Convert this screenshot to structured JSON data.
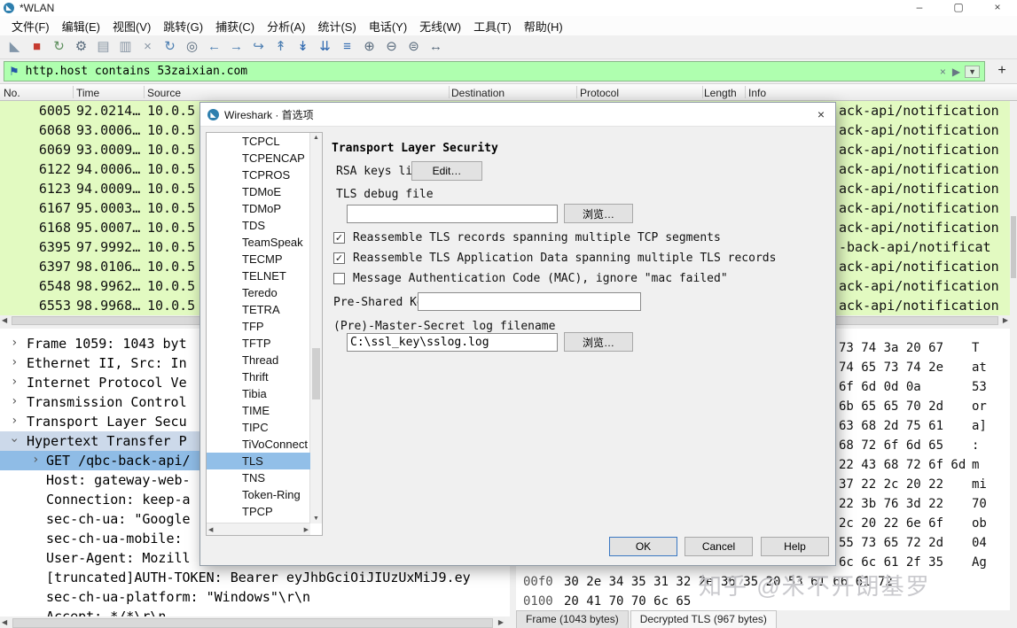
{
  "window": {
    "title": "*WLAN",
    "watermark": "知乎 @米不开朗基罗"
  },
  "menu": {
    "items": [
      "文件(F)",
      "编辑(E)",
      "视图(V)",
      "跳转(G)",
      "捕获(C)",
      "分析(A)",
      "统计(S)",
      "电话(Y)",
      "无线(W)",
      "工具(T)",
      "帮助(H)"
    ]
  },
  "toolbar": {
    "icons": [
      {
        "name": "start-capture-icon",
        "glyph": "◣",
        "color": "#8296a9"
      },
      {
        "name": "stop-capture-icon",
        "glyph": "■",
        "color": "#c63b30"
      },
      {
        "name": "restart-capture-icon",
        "glyph": "↻",
        "color": "#5d8f5d"
      },
      {
        "name": "capture-options-icon",
        "glyph": "⚙",
        "color": "#56687a"
      },
      {
        "name": "open-file-icon",
        "glyph": "▤",
        "color": "#8a97a5"
      },
      {
        "name": "save-file-icon",
        "glyph": "▥",
        "color": "#8a97a5"
      },
      {
        "name": "close-file-icon",
        "glyph": "×",
        "color": "#8a97a5"
      },
      {
        "name": "reload-file-icon",
        "glyph": "↻",
        "color": "#4d7fb2"
      },
      {
        "name": "find-packet-icon",
        "glyph": "◎",
        "color": "#56687a"
      },
      {
        "name": "go-back-icon",
        "glyph": "←",
        "color": "#4d7fb2"
      },
      {
        "name": "go-forward-icon",
        "glyph": "→",
        "color": "#4d7fb2"
      },
      {
        "name": "go-to-packet-icon",
        "glyph": "↪",
        "color": "#4d7fb2"
      },
      {
        "name": "go-first-packet-icon",
        "glyph": "↟",
        "color": "#4d7fb2"
      },
      {
        "name": "go-last-packet-icon",
        "glyph": "↡",
        "color": "#2e68b0"
      },
      {
        "name": "auto-scroll-icon",
        "glyph": "⇊",
        "color": "#2e68b0"
      },
      {
        "name": "colorize-icon",
        "glyph": "≡",
        "color": "#2e68b0"
      },
      {
        "name": "zoom-in-icon",
        "glyph": "⊕",
        "color": "#56687a"
      },
      {
        "name": "zoom-out-icon",
        "glyph": "⊖",
        "color": "#56687a"
      },
      {
        "name": "zoom-reset-icon",
        "glyph": "⊜",
        "color": "#56687a"
      },
      {
        "name": "resize-columns-icon",
        "glyph": "↔",
        "color": "#56687a"
      }
    ]
  },
  "filter": {
    "value": "http.host contains 53zaixian.com",
    "add_label": "+",
    "icons": {
      "bookmark": "⚑",
      "clear": "×",
      "apply": "▶",
      "dropdown": "▼"
    }
  },
  "packet_list": {
    "columns": [
      "No.",
      "Time",
      "Source",
      "Destination",
      "Protocol",
      "Length",
      "Info"
    ],
    "rows": [
      {
        "no": "6005",
        "time": "92.0214…",
        "source": "10.0.5",
        "info": "ack-api/notification"
      },
      {
        "no": "6068",
        "time": "93.0006…",
        "source": "10.0.5",
        "info": "ack-api/notification"
      },
      {
        "no": "6069",
        "time": "93.0009…",
        "source": "10.0.5",
        "info": "ack-api/notification"
      },
      {
        "no": "6122",
        "time": "94.0006…",
        "source": "10.0.5",
        "info": "ack-api/notification"
      },
      {
        "no": "6123",
        "time": "94.0009…",
        "source": "10.0.5",
        "info": "ack-api/notification"
      },
      {
        "no": "6167",
        "time": "95.0003…",
        "source": "10.0.5",
        "info": "ack-api/notification"
      },
      {
        "no": "6168",
        "time": "95.0007…",
        "source": "10.0.5",
        "info": "ack-api/notification"
      },
      {
        "no": "6395",
        "time": "97.9992…",
        "source": "10.0.5",
        "info": "-back-api/notificat"
      },
      {
        "no": "6397",
        "time": "98.0106…",
        "source": "10.0.5",
        "info": "ack-api/notification"
      },
      {
        "no": "6548",
        "time": "98.9962…",
        "source": "10.0.5",
        "info": "ack-api/notification"
      },
      {
        "no": "6553",
        "time": "98.9968…",
        "source": "10.0.5",
        "info": "ack-api/notification"
      }
    ]
  },
  "details": {
    "rows": [
      {
        "text": "Frame 1059: 1043 byt",
        "chev": "right",
        "indent": 0,
        "hl": ""
      },
      {
        "text": "Ethernet II, Src: In",
        "chev": "right",
        "indent": 0,
        "hl": ""
      },
      {
        "text": "Internet Protocol Ve",
        "chev": "right",
        "indent": 0,
        "hl": ""
      },
      {
        "text": "Transmission Control",
        "chev": "right",
        "indent": 0,
        "hl": ""
      },
      {
        "text": "Transport Layer Secu",
        "chev": "right",
        "indent": 0,
        "hl": ""
      },
      {
        "text": "Hypertext Transfer P",
        "chev": "down",
        "indent": 0,
        "hl": "soft"
      },
      {
        "text": "GET /qbc-back-api/",
        "chev": "right",
        "indent": 1,
        "hl": "selected"
      },
      {
        "text": "Host: gateway-web-",
        "chev": "",
        "indent": 1,
        "hl": ""
      },
      {
        "text": "Connection: keep-a",
        "chev": "",
        "indent": 1,
        "hl": ""
      },
      {
        "text": "sec-ch-ua: \"Google",
        "chev": "",
        "indent": 1,
        "hl": ""
      },
      {
        "text": "sec-ch-ua-mobile: ",
        "chev": "",
        "indent": 1,
        "hl": ""
      },
      {
        "text": "User-Agent: Mozill",
        "chev": "",
        "indent": 1,
        "hl": ""
      },
      {
        "text": "[truncated]AUTH-TOKEN: Bearer eyJhbGciOiJIUzUxMiJ9.ey",
        "chev": "",
        "indent": 1,
        "hl": ""
      },
      {
        "text": "sec-ch-ua-platform: \"Windows\"\\r\\n",
        "chev": "",
        "indent": 1,
        "hl": ""
      },
      {
        "text": "Accept: */*\\r\\n",
        "chev": "",
        "indent": 1,
        "hl": ""
      }
    ]
  },
  "bytes": {
    "rows": [
      {
        "offset": "",
        "hex": "73 74 3a 20 67",
        "ascii": "T"
      },
      {
        "offset": "",
        "hex": "74 65 73 74 2e",
        "ascii": "at"
      },
      {
        "offset": "",
        "hex": "6f 6d 0d 0a",
        "ascii": "53"
      },
      {
        "offset": "",
        "hex": "6b 65 65 70 2d",
        "ascii": "or"
      },
      {
        "offset": "",
        "hex": "63 68 2d 75 61",
        "ascii": "a]"
      },
      {
        "offset": "",
        "hex": "68 72 6f 6d 65",
        "ascii": ":"
      },
      {
        "offset": "",
        "hex": "22 43 68 72 6f 6d",
        "ascii": "m"
      },
      {
        "offset": "",
        "hex": "37 22 2c 20 22",
        "ascii": "mi"
      },
      {
        "offset": "",
        "hex": "22 3b 76 3d 22",
        "ascii": "70"
      },
      {
        "offset": "",
        "hex": "2c 20 22 6e 6f",
        "ascii": "ob"
      },
      {
        "offset": "",
        "hex": "55 73 65 72 2d",
        "ascii": "04"
      },
      {
        "offset": "",
        "hex": "6c 6c 61 2f 35",
        "ascii": "Ag"
      },
      {
        "offset": "00f0",
        "hex": "30 2e 34 35 31 32 2e 36 35 20 53 61 66 61 72",
        "ascii": ""
      },
      {
        "offset": "0100",
        "hex": "20 41 70 70 6c 65",
        "ascii": ""
      }
    ],
    "tabs": [
      "Frame (1043 bytes)",
      "Decrypted TLS (967 bytes)"
    ],
    "active_tab": 1
  },
  "dialog": {
    "title": "Wireshark · 首选项",
    "protocols": [
      "TCPCL",
      "TCPENCAP",
      "TCPROS",
      "TDMoE",
      "TDMoP",
      "TDS",
      "TeamSpeak",
      "TECMP",
      "TELNET",
      "Teredo",
      "TETRA",
      "TFP",
      "TFTP",
      "Thread",
      "Thrift",
      "Tibia",
      "TIME",
      "TIPC",
      "TiVoConnect",
      "TLS",
      "TNS",
      "Token-Ring",
      "TPCP"
    ],
    "selected_protocol": "TLS",
    "panel": {
      "heading": "Transport Layer Security",
      "rsa_label": "RSA keys list",
      "edit_button": "Edit…",
      "debug_label": "TLS debug file",
      "debug_value": "",
      "browse_button": "浏览…",
      "checkboxes": [
        {
          "label": "Reassemble TLS records spanning multiple TCP segments",
          "checked": true
        },
        {
          "label": "Reassemble TLS Application Data spanning multiple TLS records",
          "checked": true
        },
        {
          "label": "Message Authentication Code (MAC), ignore \"mac failed\"",
          "checked": false
        }
      ],
      "psk_label": "Pre-Shared Key",
      "psk_value": "",
      "keylog_label": "(Pre)-Master-Secret log filename",
      "keylog_value": "C:\\ssl_key\\sslog.log",
      "browse_button2": "浏览…"
    },
    "buttons": {
      "ok": "OK",
      "cancel": "Cancel",
      "help": "Help"
    }
  }
}
